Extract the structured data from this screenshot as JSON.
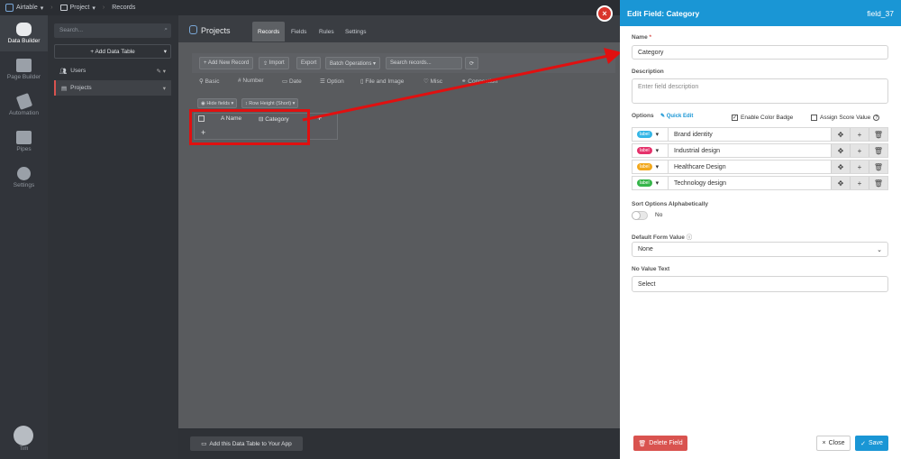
{
  "topbar": {
    "app": "Airtable",
    "project": "Project",
    "page": "Records"
  },
  "rail": {
    "items": [
      "Data Builder",
      "Page Builder",
      "Automation",
      "Pipes",
      "Settings"
    ],
    "user": "Tim"
  },
  "sidebar": {
    "search_placeholder": "Search...",
    "add_table": "+ Add Data Table",
    "items": [
      "Users",
      "Projects"
    ]
  },
  "main": {
    "title": "Projects",
    "tabs": [
      "Records",
      "Fields",
      "Rules",
      "Settings"
    ],
    "toolbar": {
      "add": "+ Add New Record",
      "import": "Import",
      "export": "Export",
      "batch": "Batch Operations ▾",
      "search_placeholder": "Search records..."
    },
    "field_types": [
      "Basic",
      "Number",
      "Date",
      "Option",
      "File and Image",
      "Misc",
      "Connection"
    ],
    "view": {
      "hide": "Hide fields ▾",
      "row_height": "Row Height (Short) ▾"
    },
    "columns": [
      "Name",
      "Category"
    ],
    "add_row": "+",
    "add_col": "+",
    "add_to_app": "Add this Data Table to Your App"
  },
  "panel": {
    "title": "Edit Field: Category",
    "field_id": "field_37",
    "name_label": "Name",
    "required_mark": "*",
    "name_value": "Category",
    "desc_label": "Description",
    "desc_placeholder": "Enter field description",
    "options_label": "Options",
    "quick_edit": "Quick Edit",
    "enable_badge": "Enable Color Badge",
    "enable_badge_checked": true,
    "assign_score": "Assign Score Value",
    "assign_score_checked": false,
    "options": [
      {
        "badge": "label",
        "color": "#35b6e6",
        "text": "Brand identity"
      },
      {
        "badge": "label",
        "color": "#e5326b",
        "text": "Industrial design"
      },
      {
        "badge": "label",
        "color": "#f2a81d",
        "text": "Healthcare Design"
      },
      {
        "badge": "label",
        "color": "#36b54a",
        "text": "Technology design"
      }
    ],
    "sort_label": "Sort Options Alphabetically",
    "sort_value": "No",
    "default_label": "Default Form Value",
    "default_value": "None",
    "novalue_label": "No Value Text",
    "novalue_value": "Select",
    "delete_btn": "Delete Field",
    "close_btn": "Close",
    "save_btn": "Save",
    "colors": {
      "header": "#1a96d5",
      "delete": "#d9534f",
      "save": "#1a96d5"
    }
  }
}
